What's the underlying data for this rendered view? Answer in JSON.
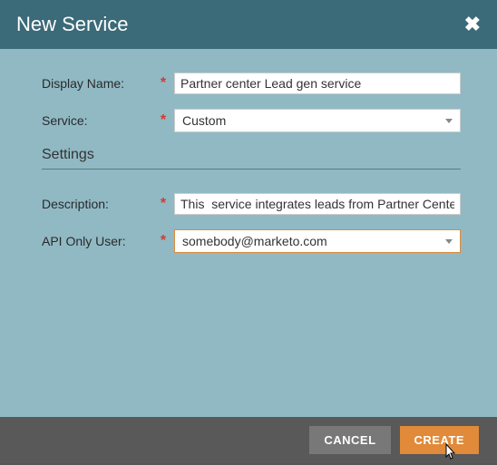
{
  "dialog": {
    "title": "New Service",
    "close_icon": "✖"
  },
  "form": {
    "display_name": {
      "label": "Display Name:",
      "value": "Partner center Lead gen service"
    },
    "service": {
      "label": "Service:",
      "selected": "Custom"
    },
    "settings_heading": "Settings",
    "description": {
      "label": "Description:",
      "value": "This  service integrates leads from Partner Center"
    },
    "api_only_user": {
      "label": "API Only User:",
      "selected": "somebody@marketo.com"
    }
  },
  "footer": {
    "cancel": "CANCEL",
    "create": "CREATE"
  }
}
